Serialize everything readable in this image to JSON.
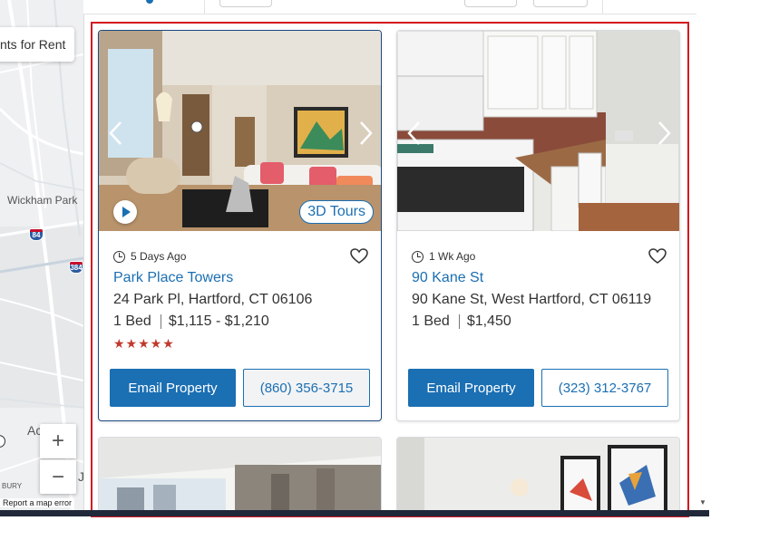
{
  "map": {
    "search_pill": "nts for Rent",
    "place_label": "Wickham Park",
    "place_label_2": "Ac",
    "place_label_3": "J",
    "place_label_4": "BURY",
    "shield_84": "84",
    "shield_384": "384",
    "zoom_in": "+",
    "zoom_out": "−",
    "report_error": "Report a map error"
  },
  "listings": [
    {
      "posted": "5 Days Ago",
      "name": "Park Place Towers",
      "address": "24 Park Pl, Hartford, CT 06106",
      "beds": "1 Bed",
      "price": "$1,115 - $1,210",
      "stars": "★★★★★",
      "tour_badge": "3D Tours",
      "email_label": "Email Property",
      "phone": "(860) 356-3715"
    },
    {
      "posted": "1 Wk Ago",
      "name": "90 Kane St",
      "address": "90 Kane St, West Hartford, CT 06119",
      "beds": "1 Bed",
      "price": "$1,450",
      "email_label": "Email Property",
      "phone": "(323) 312-3767"
    }
  ],
  "colors": {
    "accent": "#1b6fb3",
    "stars": "#c0392b",
    "highlight_border": "#d3191f"
  },
  "icons": [
    "clock-icon",
    "heart-icon",
    "chevron-left-icon",
    "chevron-right-icon",
    "play-icon"
  ]
}
